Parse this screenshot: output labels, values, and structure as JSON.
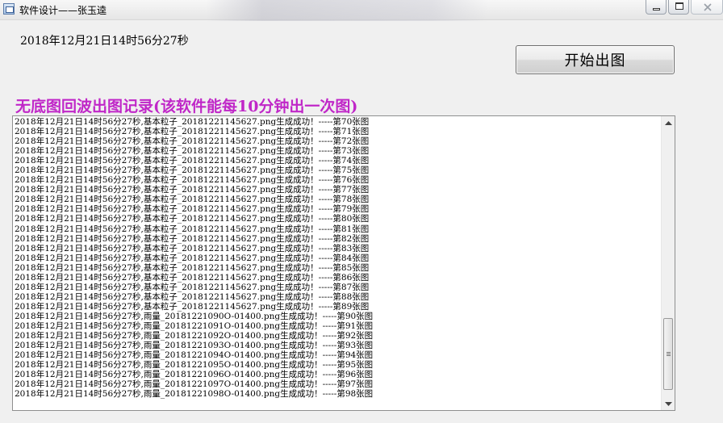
{
  "window": {
    "title": "软件设计——张玉逵",
    "controls": [
      "minimize-icon",
      "maximize-icon",
      "close-icon"
    ]
  },
  "datetime": "2018年12月21日14时56分27秒",
  "start_button": "开始出图",
  "section_title": "无底图回波出图记录(该软件能每10分钟出一次图)",
  "log": [
    "2018年12月21日14时56分27秒,基本粒子_20181221145627.png生成成功！-----第70张图",
    "2018年12月21日14时56分27秒,基本粒子_20181221145627.png生成成功！-----第71张图",
    "2018年12月21日14时56分27秒,基本粒子_20181221145627.png生成成功！-----第72张图",
    "2018年12月21日14时56分27秒,基本粒子_20181221145627.png生成成功！-----第73张图",
    "2018年12月21日14时56分27秒,基本粒子_20181221145627.png生成成功！-----第74张图",
    "2018年12月21日14时56分27秒,基本粒子_20181221145627.png生成成功！-----第75张图",
    "2018年12月21日14时56分27秒,基本粒子_20181221145627.png生成成功！-----第76张图",
    "2018年12月21日14时56分27秒,基本粒子_20181221145627.png生成成功！-----第77张图",
    "2018年12月21日14时56分27秒,基本粒子_20181221145627.png生成成功！-----第78张图",
    "2018年12月21日14时56分27秒,基本粒子_20181221145627.png生成成功！-----第79张图",
    "2018年12月21日14时56分27秒,基本粒子_20181221145627.png生成成功！-----第80张图",
    "2018年12月21日14时56分27秒,基本粒子_20181221145627.png生成成功！-----第81张图",
    "2018年12月21日14时56分27秒,基本粒子_20181221145627.png生成成功！-----第82张图",
    "2018年12月21日14时56分27秒,基本粒子_20181221145627.png生成成功！-----第83张图",
    "2018年12月21日14时56分27秒,基本粒子_20181221145627.png生成成功！-----第84张图",
    "2018年12月21日14时56分27秒,基本粒子_20181221145627.png生成成功！-----第85张图",
    "2018年12月21日14时56分27秒,基本粒子_20181221145627.png生成成功！-----第86张图",
    "2018年12月21日14时56分27秒,基本粒子_20181221145627.png生成成功！-----第87张图",
    "2018年12月21日14时56分27秒,基本粒子_20181221145627.png生成成功！-----第88张图",
    "2018年12月21日14时56分27秒,基本粒子_20181221145627.png生成成功！-----第89张图",
    "2018年12月21日14时56分27秒,雨量_20181221090O-01400.png生成成功！-----第90张图",
    "2018年12月21日14时56分27秒,雨量_20181221091O-01400.png生成成功！-----第91张图",
    "2018年12月21日14时56分27秒,雨量_20181221092O-01400.png生成成功！-----第92张图",
    "2018年12月21日14时56分27秒,雨量_20181221093O-01400.png生成成功！-----第93张图",
    "2018年12月21日14时56分27秒,雨量_20181221094O-01400.png生成成功！-----第94张图",
    "2018年12月21日14时56分27秒,雨量_20181221095O-01400.png生成成功！-----第95张图",
    "2018年12月21日14时56分27秒,雨量_20181221096O-01400.png生成成功！-----第96张图",
    "2018年12月21日14时56分27秒,雨量_20181221097O-01400.png生成成功！-----第97张图",
    "2018年12月21日14时56分27秒,雨量_20181221098O-01400.png生成成功！-----第98张图"
  ],
  "scroll_position": 0.92
}
